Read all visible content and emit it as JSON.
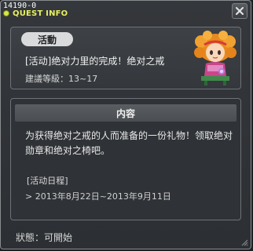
{
  "header": {
    "quest_id": "14190-0",
    "title": "QUEST INFO"
  },
  "summary": {
    "category": "活動",
    "quest_name": "[活动]绝对力里的完成！绝对之戒",
    "level_label": "建議等級",
    "level_value": "13~17",
    "level_line": "建議等級：13~17"
  },
  "content": {
    "header": "内容",
    "description_line1": "为获得绝对之戒的人而准备的一份礼物！领取绝对",
    "description_line2": "勋章和绝对之椅吧。",
    "schedule_label": "[活动日程]",
    "schedule_range": "> 2013年8月22日~2013年9月11日"
  },
  "status": {
    "line": "狀態：可開始"
  },
  "colors": {
    "title_accent": "#e8f060",
    "badge_bg": "#d9dadb",
    "panel_bg": "#2f3236"
  },
  "icons": {
    "close": "close-icon",
    "title_marker": "dot-icon",
    "resize": "resize-grip-icon"
  }
}
